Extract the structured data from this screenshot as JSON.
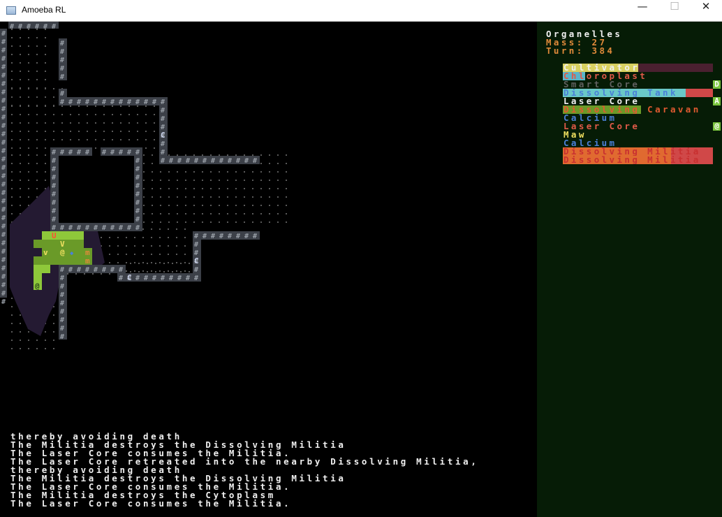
{
  "window": {
    "title": "Amoeba RL",
    "minimize": "—",
    "maximize": "☐",
    "close": "✕"
  },
  "panel": {
    "heading": "Organelles",
    "mass_label": "Mass: 27",
    "turn_label": "Turn: 384",
    "colors": {
      "background": "#061c06",
      "heading": "#f0f0f0",
      "stats": "#e08a3a"
    }
  },
  "organelles": [
    {
      "name": "Cultivator",
      "color": "#f0f0f0",
      "bar_color": "#d8d060",
      "bar_fill": 0.5,
      "track_color": "#4a2030",
      "badge": ""
    },
    {
      "name": "Chloroplast",
      "color": "#e05a48",
      "bar_color": "#5ab4c8",
      "bar_fill": 0.15,
      "track_color": "",
      "badge": ""
    },
    {
      "name": "Smart Core",
      "color": "#606060",
      "bar_color": "",
      "bar_fill": 0,
      "track_color": "",
      "badge": "D"
    },
    {
      "name": "Dissolving Tank",
      "color": "#4a80d8",
      "bar_color": "#6ac8c8",
      "bar_fill": 0.82,
      "track_color": "#d04848",
      "badge": ""
    },
    {
      "name": "Laser Core",
      "color": "#f0f0f0",
      "bar_color": "",
      "bar_fill": 0,
      "track_color": "",
      "badge": "A"
    },
    {
      "name": "Dissolving Caravan",
      "color": "#e05a30",
      "bar_color": "#6a9a28",
      "bar_fill": 0.52,
      "track_color": "",
      "badge": ""
    },
    {
      "name": "Calcium",
      "color": "#4a80d8",
      "bar_color": "",
      "bar_fill": 0,
      "track_color": "",
      "badge": ""
    },
    {
      "name": "Laser Core",
      "color": "#e05a48",
      "bar_color": "",
      "bar_fill": 0,
      "track_color": "",
      "badge": "@"
    },
    {
      "name": "Maw",
      "color": "#f0e060",
      "bar_color": "",
      "bar_fill": 0,
      "track_color": "",
      "badge": ""
    },
    {
      "name": "Calcium",
      "color": "#4a80d8",
      "bar_color": "",
      "bar_fill": 0,
      "track_color": "",
      "badge": ""
    },
    {
      "name": "Dissolving Militia",
      "color": "#c83030",
      "bar_color": "#e06a30",
      "bar_fill": 0.72,
      "track_color": "#d04848",
      "badge": ""
    },
    {
      "name": "Dissolving Militia",
      "color": "#c83030",
      "bar_color": "#e06a30",
      "bar_fill": 0.72,
      "track_color": "#d04848",
      "badge": ""
    }
  ],
  "log": [
    "thereby avoiding death",
    "The Militia destroys the Dissolving Militia",
    "The Laser Core consumes the Militia.",
    "The Laser Core retreated into the nearby Dissolving Militia,",
    "thereby avoiding death",
    "The Militia destroys the Dissolving Militia",
    "The Laser Core consumes the Militia.",
    "The Militia destroys the Cytoplasm",
    "The Laser Core consumes the Militia."
  ],
  "map_glyphs": {
    "wall": "#",
    "floor": ".",
    "enemy": "C",
    "player": "@",
    "body_markers": [
      "U",
      "V",
      "v",
      "@",
      "m",
      "m",
      "@"
    ]
  },
  "map_colors": {
    "wall_bg": "#3c4048",
    "wall_fg": "#9aa0a8",
    "floor": "#5a5a5a",
    "shadow": "#241a32",
    "amoeba": "#6a9a28",
    "amoeba_light": "#8ec83a",
    "enemy": "#c8d0e8"
  }
}
